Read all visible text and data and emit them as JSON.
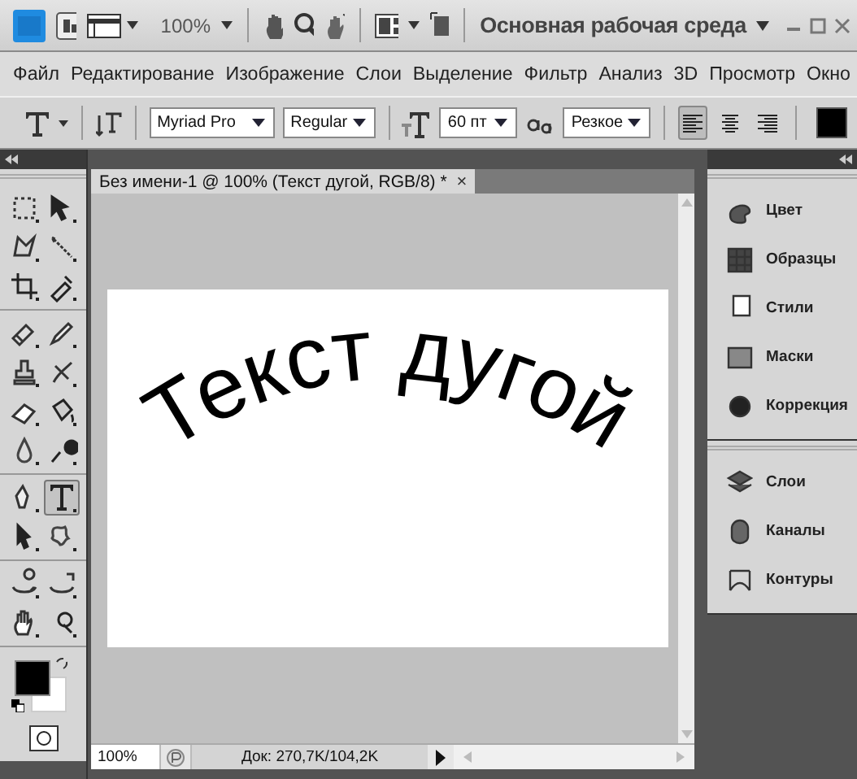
{
  "app_bar": {
    "zoom": "100%",
    "workspace": "Основная рабочая среда"
  },
  "menu": [
    "Файл",
    "Редактирование",
    "Изображение",
    "Слои",
    "Выделение",
    "Фильтр",
    "Анализ",
    "3D",
    "Просмотр",
    "Окно"
  ],
  "options": {
    "font": "Myriad Pro",
    "style": "Regular",
    "size": "60 пт",
    "antialias": "Резкое",
    "align": [
      {
        "selected": true
      },
      {
        "selected": false
      },
      {
        "selected": false
      }
    ]
  },
  "tool_groups": [
    [
      {
        "selected": false
      },
      {
        "selected": false
      },
      {
        "selected": false
      },
      {
        "selected": false
      },
      {
        "selected": false
      },
      {
        "selected": false
      }
    ],
    [
      {
        "selected": false
      },
      {
        "selected": false
      },
      {
        "selected": false
      },
      {
        "selected": false
      },
      {
        "selected": false
      },
      {
        "selected": false
      },
      {
        "selected": false
      },
      {
        "selected": false
      }
    ],
    [
      {
        "selected": false
      },
      {
        "selected": true
      },
      {
        "selected": false
      },
      {
        "selected": false
      }
    ],
    [
      {
        "selected": false
      },
      {
        "selected": false
      },
      {
        "selected": false
      },
      {
        "selected": false
      }
    ]
  ],
  "document": {
    "tab": "Без имени-1 @ 100% (Текст дугой, RGB/8) *",
    "tab_close": "×",
    "canvas_text": "Текст дугой"
  },
  "status_bar": {
    "zoom": "100%",
    "info": "Док: 270,7K/104,2K"
  },
  "panel_groups": [
    [
      {
        "label": "Цвет"
      },
      {
        "label": "Образцы"
      },
      {
        "label": "Стили"
      },
      {
        "label": "Маски"
      },
      {
        "label": "Коррекция"
      }
    ],
    [
      {
        "label": "Слои"
      },
      {
        "label": "Каналы"
      },
      {
        "label": "Контуры"
      }
    ]
  ]
}
